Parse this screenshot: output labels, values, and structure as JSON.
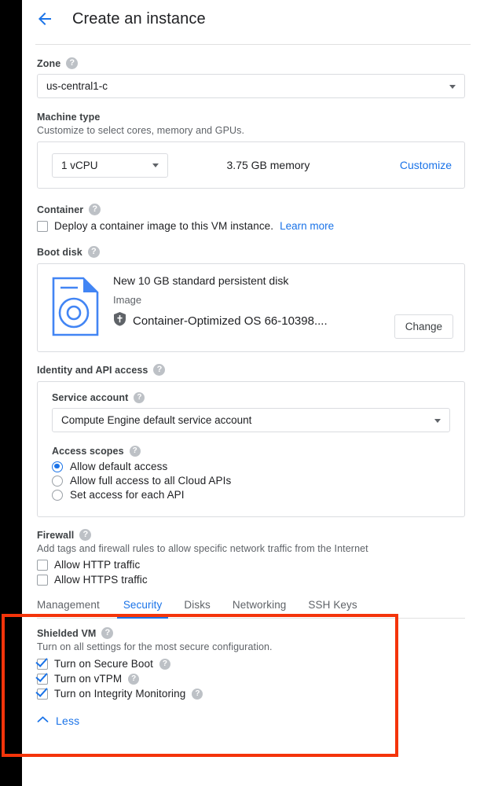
{
  "header": {
    "back_icon": "arrow-left-icon",
    "title": "Create an instance"
  },
  "form": {
    "zone": {
      "label": "Zone",
      "help_icon": "help-icon",
      "value": "us-central1-c",
      "caret_icon": "chevron-down-icon"
    },
    "machine_type": {
      "label": "Machine type",
      "description": "Customize to select cores, memory and GPUs.",
      "cpu_value": "1 vCPU",
      "memory_value": "3.75 GB memory",
      "customize_label": "Customize"
    },
    "container": {
      "label": "Container",
      "help_icon": "help-icon",
      "checkbox_checked": false,
      "checkbox_label": "Deploy a container image to this VM instance.",
      "learn_more_label": "Learn more"
    },
    "boot_disk": {
      "label": "Boot disk",
      "help_icon": "help-icon",
      "disk_icon": "disk-icon",
      "title": "New 10 GB standard persistent disk",
      "image_label": "Image",
      "shield_icon": "shield-icon",
      "image_name": "Container-Optimized OS 66-10398....",
      "change_button": "Change"
    },
    "identity": {
      "label": "Identity and API access",
      "help_icon": "help-icon",
      "service_account": {
        "label": "Service account",
        "help_icon": "help-icon",
        "value": "Compute Engine default service account",
        "caret_icon": "chevron-down-icon"
      },
      "access_scopes": {
        "label": "Access scopes",
        "help_icon": "help-icon",
        "options": [
          {
            "label": "Allow default access",
            "selected": true
          },
          {
            "label": "Allow full access to all Cloud APIs",
            "selected": false
          },
          {
            "label": "Set access for each API",
            "selected": false
          }
        ]
      }
    },
    "firewall": {
      "label": "Firewall",
      "help_icon": "help-icon",
      "description": "Add tags and firewall rules to allow specific network traffic from the Internet",
      "options": [
        {
          "label": "Allow HTTP traffic",
          "checked": false
        },
        {
          "label": "Allow HTTPS traffic",
          "checked": false
        }
      ]
    },
    "tabs": [
      {
        "label": "Management",
        "active": false
      },
      {
        "label": "Security",
        "active": true
      },
      {
        "label": "Disks",
        "active": false
      },
      {
        "label": "Networking",
        "active": false
      },
      {
        "label": "SSH Keys",
        "active": false
      }
    ],
    "security_panel": {
      "label": "Shielded VM",
      "help_icon": "help-icon",
      "description": "Turn on all settings for the most secure configuration.",
      "options": [
        {
          "label": "Turn on Secure Boot",
          "checked": true,
          "help_icon": "help-icon"
        },
        {
          "label": "Turn on vTPM",
          "checked": true,
          "help_icon": "help-icon"
        },
        {
          "label": "Turn on Integrity Monitoring",
          "checked": true,
          "help_icon": "help-icon"
        }
      ]
    },
    "less_toggle": {
      "icon": "chevron-up-icon",
      "label": "Less"
    }
  },
  "annotation": {
    "type": "highlight-rectangle",
    "color": "#f4340a"
  },
  "colors": {
    "accent_blue": "#1a73e8",
    "text_primary": "#202124",
    "text_secondary": "#5f6368",
    "border": "#dadce0",
    "annotation_red": "#f4340a"
  }
}
